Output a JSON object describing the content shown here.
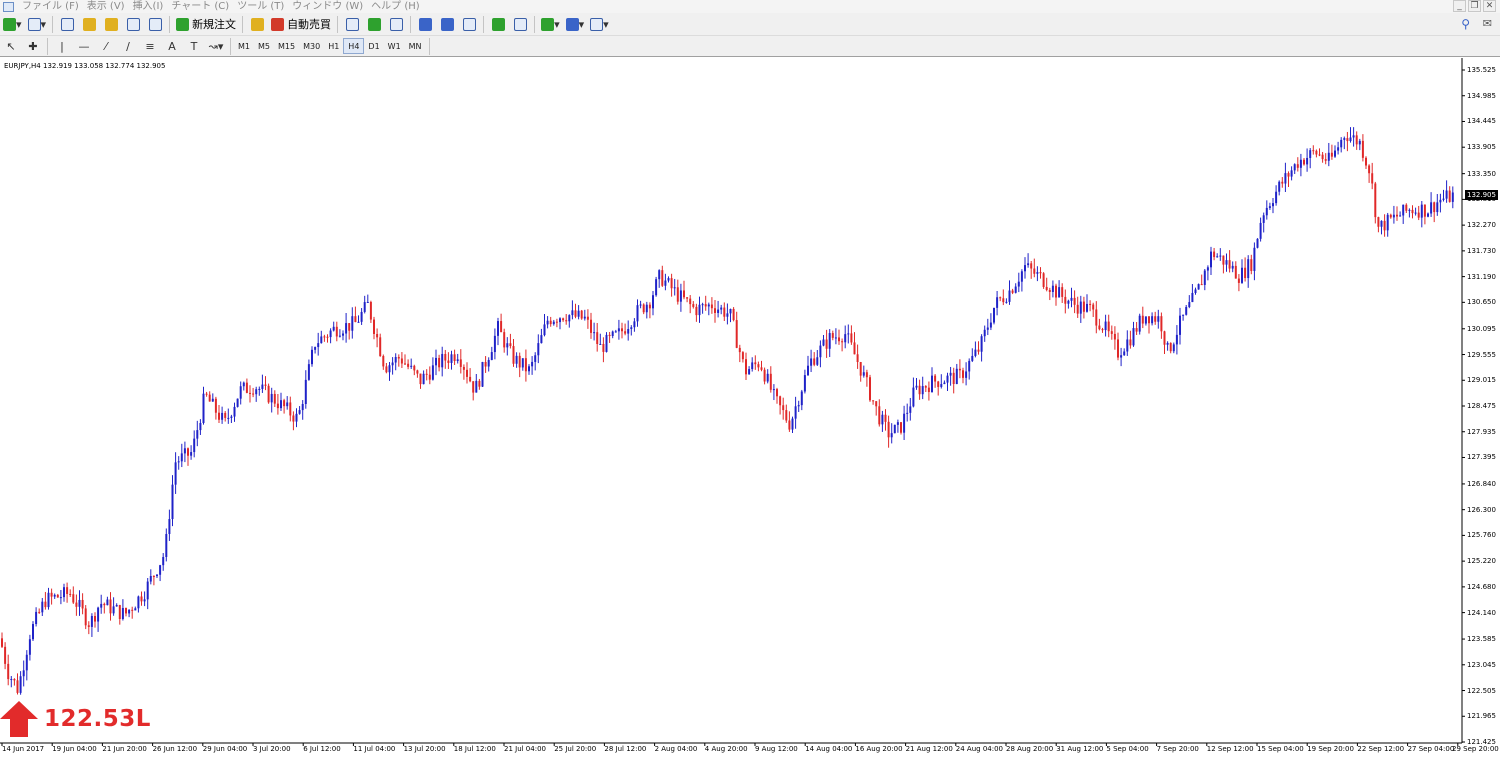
{
  "menu": {
    "items": [
      "ファイル (F)",
      "表示 (V)",
      "挿入(I)",
      "チャート (C)",
      "ツール (T)",
      "ウィンドウ (W)",
      "ヘルプ (H)"
    ]
  },
  "window_controls": {
    "minimize": "_",
    "restore": "❐",
    "close": "✕"
  },
  "toolbar": {
    "new_order_label": "新規注文",
    "auto_trade_label": "自動売買"
  },
  "timeframes": {
    "items": [
      "M1",
      "M5",
      "M15",
      "M30",
      "H1",
      "H4",
      "D1",
      "W1",
      "MN"
    ],
    "active": "H4"
  },
  "chart": {
    "header": "EURJPY,H4  132.919 133.058 132.774 132.905",
    "current_price": "132.905",
    "annotation": "122.53L",
    "colors": {
      "bull": "#1f22c8",
      "bear": "#e02828",
      "text": "#000000"
    }
  },
  "chart_data": {
    "type": "candlestick",
    "symbol": "EURJPY",
    "timeframe": "H4",
    "ohlc_last": {
      "open": 132.919,
      "high": 133.058,
      "low": 132.774,
      "close": 132.905
    },
    "y_ticks": [
      "135.525",
      "134.985",
      "134.445",
      "133.905",
      "133.350",
      "132.810",
      "132.270",
      "131.730",
      "131.190",
      "130.650",
      "130.095",
      "129.555",
      "129.015",
      "128.475",
      "127.935",
      "127.395",
      "126.840",
      "126.300",
      "125.760",
      "125.220",
      "124.680",
      "124.140",
      "123.585",
      "123.045",
      "122.505",
      "121.965",
      "121.425"
    ],
    "x_ticks": [
      "14 Jun 2017",
      "19 Jun 04:00",
      "21 Jun 20:00",
      "26 Jun 12:00",
      "29 Jun 04:00",
      "3 Jul 20:00",
      "6 Jul 12:00",
      "11 Jul 04:00",
      "13 Jul 20:00",
      "18 Jul 12:00",
      "21 Jul 04:00",
      "25 Jul 20:00",
      "28 Jul 12:00",
      "2 Aug 04:00",
      "4 Aug 20:00",
      "9 Aug 12:00",
      "14 Aug 04:00",
      "16 Aug 20:00",
      "21 Aug 12:00",
      "24 Aug 04:00",
      "28 Aug 20:00",
      "31 Aug 12:00",
      "5 Sep 04:00",
      "7 Sep 20:00",
      "12 Sep 12:00",
      "15 Sep 04:00",
      "19 Sep 20:00",
      "22 Sep 12:00",
      "27 Sep 04:00",
      "29 Sep 20:00"
    ],
    "ylim": [
      121.425,
      135.525
    ],
    "path_closes": [
      [
        0,
        123.6
      ],
      [
        8,
        122.9
      ],
      [
        18,
        122.53
      ],
      [
        30,
        123.7
      ],
      [
        45,
        124.4
      ],
      [
        70,
        124.55
      ],
      [
        90,
        123.9
      ],
      [
        100,
        124.35
      ],
      [
        125,
        124.1
      ],
      [
        145,
        124.6
      ],
      [
        165,
        125.4
      ],
      [
        175,
        127.3
      ],
      [
        192,
        127.5
      ],
      [
        205,
        128.7
      ],
      [
        225,
        128.1
      ],
      [
        240,
        128.8
      ],
      [
        255,
        128.9
      ],
      [
        275,
        128.6
      ],
      [
        298,
        128.2
      ],
      [
        315,
        129.8
      ],
      [
        335,
        130.1
      ],
      [
        355,
        130.2
      ],
      [
        368,
        130.6
      ],
      [
        385,
        129.3
      ],
      [
        400,
        129.5
      ],
      [
        420,
        129.0
      ],
      [
        440,
        129.4
      ],
      [
        458,
        129.6
      ],
      [
        475,
        128.8
      ],
      [
        498,
        130.1
      ],
      [
        512,
        129.5
      ],
      [
        530,
        129.2
      ],
      [
        548,
        130.3
      ],
      [
        565,
        130.4
      ],
      [
        585,
        130.3
      ],
      [
        600,
        129.7
      ],
      [
        620,
        130.0
      ],
      [
        635,
        130.4
      ],
      [
        650,
        130.7
      ],
      [
        660,
        131.2
      ],
      [
        678,
        130.8
      ],
      [
        695,
        130.5
      ],
      [
        712,
        130.6
      ],
      [
        730,
        130.4
      ],
      [
        745,
        129.2
      ],
      [
        760,
        129.4
      ],
      [
        775,
        128.6
      ],
      [
        790,
        128.1
      ],
      [
        810,
        129.4
      ],
      [
        830,
        129.9
      ],
      [
        845,
        130.0
      ],
      [
        860,
        129.3
      ],
      [
        878,
        128.3
      ],
      [
        888,
        127.9
      ],
      [
        900,
        128.0
      ],
      [
        915,
        128.8
      ],
      [
        935,
        129.0
      ],
      [
        960,
        129.1
      ],
      [
        980,
        129.7
      ],
      [
        995,
        130.6
      ],
      [
        1010,
        130.9
      ],
      [
        1025,
        131.4
      ],
      [
        1045,
        131.1
      ],
      [
        1060,
        130.8
      ],
      [
        1075,
        130.6
      ],
      [
        1090,
        130.5
      ],
      [
        1105,
        130.1
      ],
      [
        1118,
        129.6
      ],
      [
        1130,
        129.9
      ],
      [
        1145,
        130.4
      ],
      [
        1160,
        130.3
      ],
      [
        1168,
        129.6
      ],
      [
        1180,
        130.2
      ],
      [
        1198,
        130.9
      ],
      [
        1212,
        131.7
      ],
      [
        1225,
        131.5
      ],
      [
        1240,
        131.2
      ],
      [
        1252,
        131.5
      ],
      [
        1262,
        132.5
      ],
      [
        1280,
        133.1
      ],
      [
        1298,
        133.6
      ],
      [
        1315,
        133.8
      ],
      [
        1330,
        133.6
      ],
      [
        1345,
        134.2
      ],
      [
        1360,
        134.0
      ],
      [
        1370,
        133.4
      ],
      [
        1378,
        132.2
      ],
      [
        1392,
        132.4
      ],
      [
        1410,
        132.6
      ],
      [
        1428,
        132.6
      ],
      [
        1440,
        132.8
      ],
      [
        1455,
        132.9
      ]
    ]
  }
}
